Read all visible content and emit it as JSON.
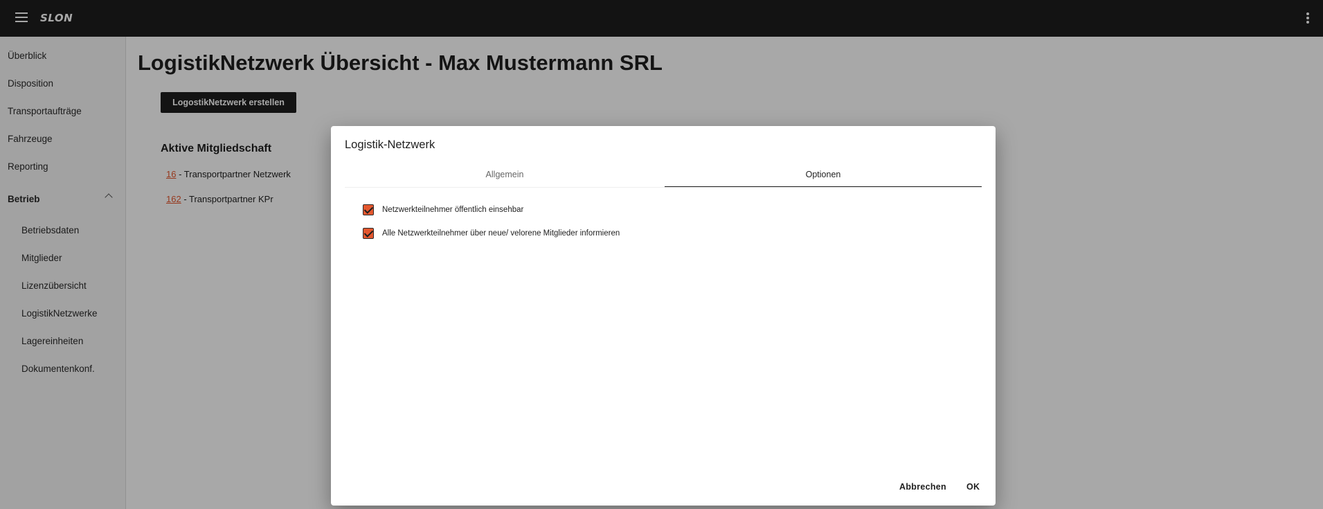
{
  "app": {
    "logo_text": "SLON",
    "menu_icon": "hamburger-menu-icon",
    "more_icon": "more-vert-icon"
  },
  "sidebar": {
    "items": [
      {
        "label": "Überblick"
      },
      {
        "label": "Disposition"
      },
      {
        "label": "Transportaufträge"
      },
      {
        "label": "Fahrzeuge"
      },
      {
        "label": "Reporting"
      }
    ],
    "group": {
      "label": "Betrieb",
      "expanded_icon": "chevron-up-icon",
      "children": [
        {
          "label": "Betriebsdaten"
        },
        {
          "label": "Mitglieder"
        },
        {
          "label": "Lizenzübersicht"
        },
        {
          "label": "LogistikNetzwerke"
        },
        {
          "label": "Lagereinheiten"
        },
        {
          "label": "Dokumentenkonf."
        }
      ]
    }
  },
  "main": {
    "title": "LogistikNetzwerk Übersicht - Max Mustermann SRL",
    "create_button": "LogostikNetzwerk erstellen",
    "section_title": "Aktive Mitgliedschaft",
    "memberships": [
      {
        "id": "16",
        "name": " - Transportpartner Netzwerk"
      },
      {
        "id": "162",
        "name": " - Transportpartner KPr"
      }
    ]
  },
  "dialog": {
    "title": "Logistik-Netzwerk",
    "tabs": [
      {
        "label": "Allgemein",
        "active": false
      },
      {
        "label": "Optionen",
        "active": true
      }
    ],
    "options": [
      {
        "label": "Netzwerkteilnehmer öffentlich einsehbar",
        "checked": true
      },
      {
        "label": "Alle Netzwerkteilnehmer über neue/ velorene Mitglieder informieren",
        "checked": true
      }
    ],
    "cancel_label": "Abbrechen",
    "ok_label": "OK"
  },
  "colors": {
    "accent": "#e4572e",
    "topbar": "#1e1e1e",
    "overlay": "rgba(0,0,0,0.34)"
  }
}
